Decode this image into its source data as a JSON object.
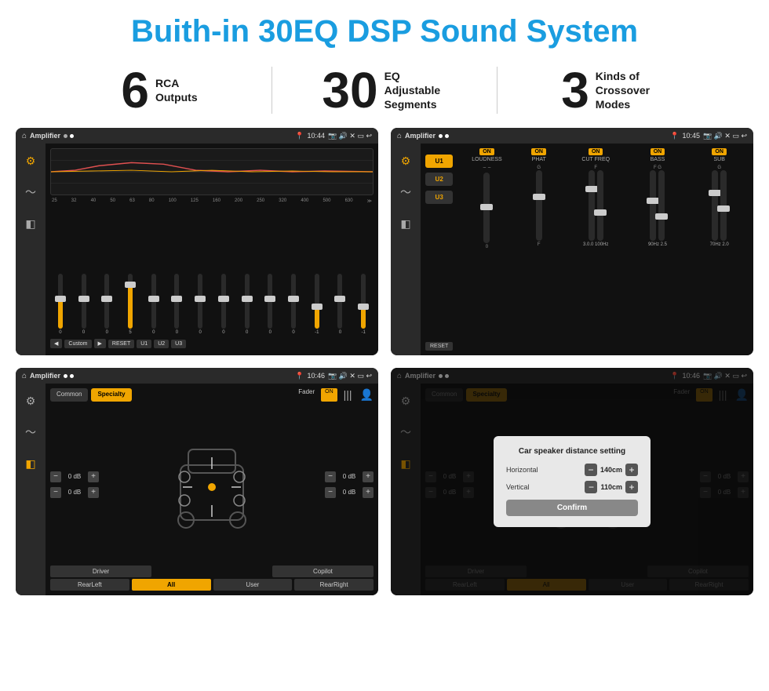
{
  "page": {
    "title": "Buith-in 30EQ DSP Sound System"
  },
  "stats": [
    {
      "number": "6",
      "text": "RCA\nOutputs"
    },
    {
      "number": "30",
      "text": "EQ Adjustable\nSegments"
    },
    {
      "number": "3",
      "text": "Kinds of\nCrossover Modes"
    }
  ],
  "screens": [
    {
      "id": "eq-screen",
      "statusBar": {
        "appName": "Amplifier",
        "time": "10:44"
      },
      "type": "eq"
    },
    {
      "id": "crossover-screen",
      "statusBar": {
        "appName": "Amplifier",
        "time": "10:45"
      },
      "type": "crossover"
    },
    {
      "id": "speaker-screen",
      "statusBar": {
        "appName": "Amplifier",
        "time": "10:46"
      },
      "type": "speaker"
    },
    {
      "id": "speaker-dialog-screen",
      "statusBar": {
        "appName": "Amplifier",
        "time": "10:46"
      },
      "type": "speaker-dialog",
      "dialog": {
        "title": "Car speaker distance setting",
        "horizontal": {
          "label": "Horizontal",
          "value": "140cm"
        },
        "vertical": {
          "label": "Vertical",
          "value": "110cm"
        },
        "confirmLabel": "Confirm"
      }
    }
  ],
  "eqFrequencies": [
    "25",
    "32",
    "40",
    "50",
    "63",
    "80",
    "100",
    "125",
    "160",
    "200",
    "250",
    "320",
    "400",
    "500",
    "630"
  ],
  "eqValues": [
    "0",
    "0",
    "0",
    "5",
    "0",
    "0",
    "0",
    "0",
    "0",
    "0",
    "0",
    "-1",
    "0",
    "-1"
  ],
  "eqButtons": [
    "Custom",
    "RESET",
    "U1",
    "U2",
    "U3"
  ],
  "crossoverPresets": [
    "U1",
    "U2",
    "U3"
  ],
  "crossoverChannels": [
    "LOUDNESS",
    "PHAT",
    "CUT FREQ",
    "BASS",
    "SUB"
  ],
  "speakerTabs": [
    "Common",
    "Specialty"
  ],
  "speakerBottomBtns": [
    "Driver",
    "RearLeft",
    "All",
    "User",
    "RearRight",
    "Copilot"
  ],
  "dialog": {
    "title": "Car speaker distance setting",
    "horizontalLabel": "Horizontal",
    "horizontalValue": "140cm",
    "verticalLabel": "Vertical",
    "verticalValue": "110cm",
    "confirmLabel": "Confirm"
  }
}
